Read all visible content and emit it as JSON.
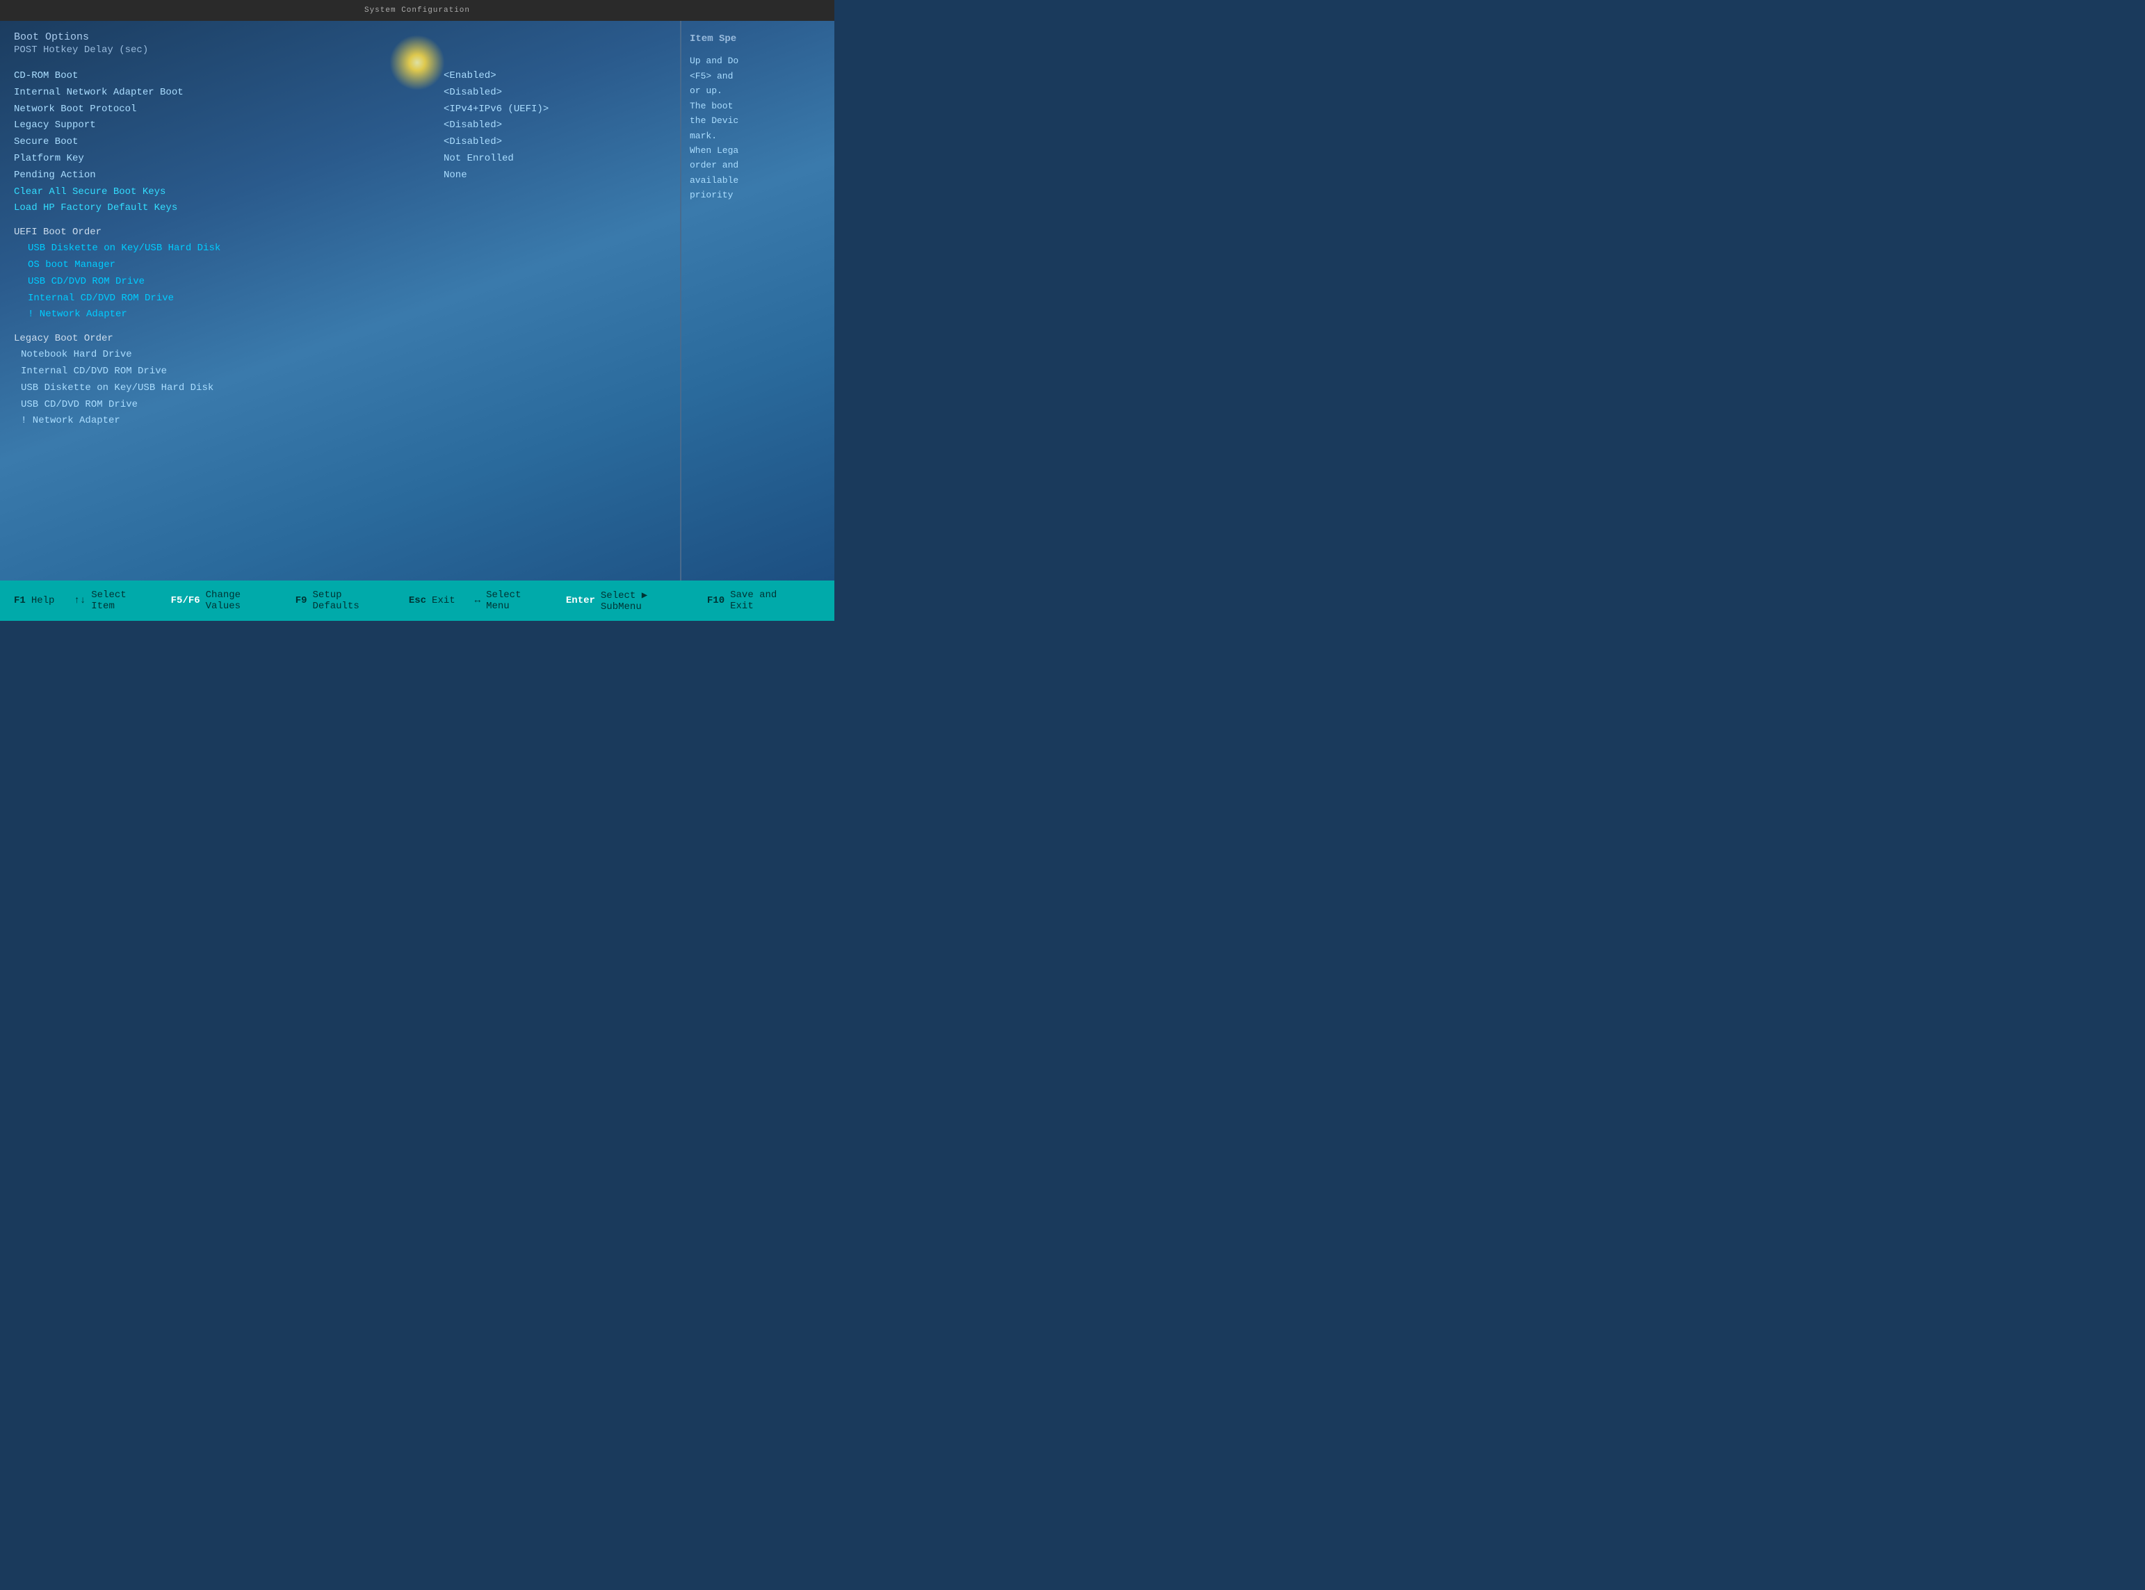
{
  "topBar": {
    "title": "System Configuration"
  },
  "header": {
    "section": "Boot Options",
    "subsection": "POST Hotkey Delay (sec)"
  },
  "menuItems": [
    {
      "label": "CD-ROM Boot",
      "value": "<Enabled>",
      "highlight": false
    },
    {
      "label": "Internal Network Adapter Boot",
      "value": "<Disabled>",
      "highlight": false
    },
    {
      "label": "Network Boot Protocol",
      "value": "<IPv4+IPv6 (UEFI)>",
      "highlight": false
    },
    {
      "label": "Legacy Support",
      "value": "<Disabled>",
      "highlight": false
    },
    {
      "label": "Secure Boot",
      "value": "<Disabled>",
      "highlight": false
    },
    {
      "label": "Platform Key",
      "value": "Not Enrolled",
      "highlight": false
    },
    {
      "label": "Pending Action",
      "value": "None",
      "highlight": false
    },
    {
      "label": "Clear All Secure Boot Keys",
      "value": "",
      "highlight": true
    },
    {
      "label": "Load HP Factory Default Keys",
      "value": "",
      "highlight": true
    }
  ],
  "uefiBootOrder": {
    "header": "UEFI Boot Order",
    "items": [
      "USB Diskette on Key/USB Hard Disk",
      "OS boot Manager",
      "USB CD/DVD ROM Drive",
      "Internal CD/DVD ROM Drive",
      "! Network Adapter"
    ]
  },
  "legacyBootOrder": {
    "header": "Legacy Boot Order",
    "items": [
      "Notebook Hard Drive",
      "Internal CD/DVD ROM Drive",
      "USB Diskette on Key/USB Hard Disk",
      "USB CD/DVD ROM Drive",
      "! Network Adapter"
    ]
  },
  "helpPanel": {
    "title": "Item Spe",
    "lines": [
      "Up and Do",
      "<F5> and",
      "or up.",
      "The boot",
      "the Devic",
      "mark.",
      "When Lega",
      "order and",
      "available",
      "priority"
    ]
  },
  "statusBar": {
    "items": [
      {
        "key": "F1",
        "desc": "Help"
      },
      {
        "key": "↑↓",
        "desc": "Select Item"
      },
      {
        "key": "F5/F6",
        "desc": "Change Values"
      },
      {
        "key": "F9",
        "desc": "Setup Defaults"
      },
      {
        "key": "Esc",
        "desc": "Exit"
      },
      {
        "key": "↔",
        "desc": "Select Menu"
      },
      {
        "key": "Enter",
        "desc": "Select ▶ SubMenu"
      },
      {
        "key": "F10",
        "desc": "Save and Exit"
      }
    ]
  }
}
